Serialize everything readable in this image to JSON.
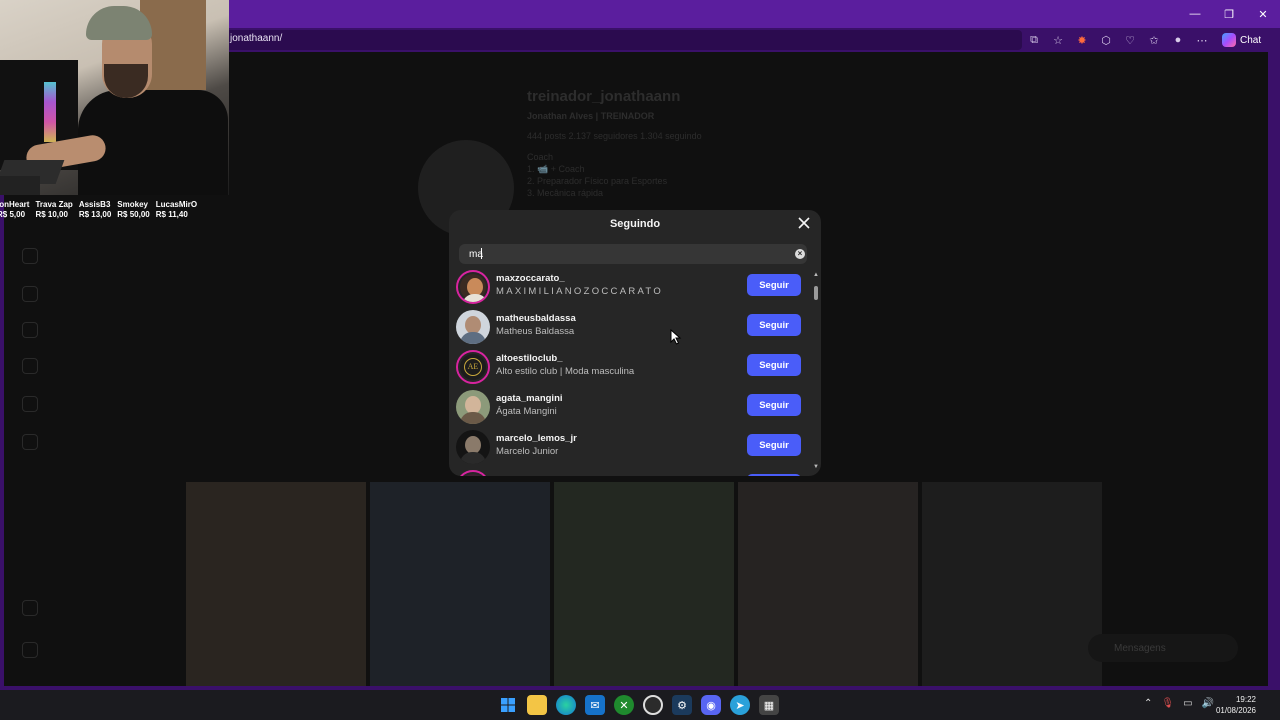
{
  "browser": {
    "url_partial": "jonathaann/",
    "chat_label": "Chat",
    "window_controls": [
      "minimize-icon",
      "restore-icon",
      "close-icon"
    ],
    "toolbar_icons": [
      "split-screen-icon",
      "favorite-star-icon",
      "extension-icon",
      "puzzle-icon",
      "performance-icon",
      "collections-icon",
      "profile-avatar-icon",
      "more-icon"
    ]
  },
  "background_profile": {
    "username": "treinador_jonathaann",
    "subtitle": "Jonathan Alves | TREINADOR",
    "stats": "444 posts   2.137 seguidores   1.304 seguindo",
    "bio_lines": [
      "Coach",
      "1. 📹 + Coach",
      "2. Preparador Físico para Esportes",
      "3. Mecânica rápida"
    ],
    "messages_label": "Mensagens"
  },
  "stream_overlay": {
    "donations": [
      {
        "name": "ionHeart",
        "amount": "R$ 5,00"
      },
      {
        "name": "Trava Zap",
        "amount": "R$ 10,00"
      },
      {
        "name": "AssisB3",
        "amount": "R$ 13,00"
      },
      {
        "name": "Smokey",
        "amount": "R$ 50,00"
      },
      {
        "name": "LucasMirO",
        "amount": "R$ 11,40"
      }
    ]
  },
  "modal": {
    "title": "Seguindo",
    "search_value": "ma",
    "follow_label": "Seguir",
    "accounts": [
      {
        "username": "maxzoccarato_",
        "full_name": "MAXIMILIANOZOCCARATO",
        "story_ring": true,
        "avatar_color": "#c98a5a"
      },
      {
        "username": "matheusbaldassa",
        "full_name": "Matheus Baldassa",
        "story_ring": false,
        "avatar_color": "#9aa6b5"
      },
      {
        "username": "altoestiloclub_",
        "full_name": "Alto estilo club | Moda masculina",
        "story_ring": true,
        "avatar_color": "#1c1c1c",
        "monogram": "AE"
      },
      {
        "username": "agata_mangini",
        "full_name": "Ágata Mangini",
        "story_ring": false,
        "avatar_color": "#8c9a7a"
      },
      {
        "username": "marcelo_lemos_jr",
        "full_name": "Marcelo Junior",
        "story_ring": false,
        "avatar_color": "#2a2a2a"
      }
    ]
  },
  "taskbar": {
    "apps": [
      "windows-start-icon",
      "file-explorer-icon",
      "edge-icon",
      "outlook-icon",
      "xbox-icon",
      "chrome-icon",
      "steam-icon",
      "discord-icon",
      "telegram-icon",
      "obs-icon"
    ],
    "time": "19:22",
    "date": "01/08/2026"
  },
  "colors": {
    "browser_frame": "#5b1e9e",
    "follow_button": "#4a5df9",
    "modal_bg": "#262626"
  }
}
